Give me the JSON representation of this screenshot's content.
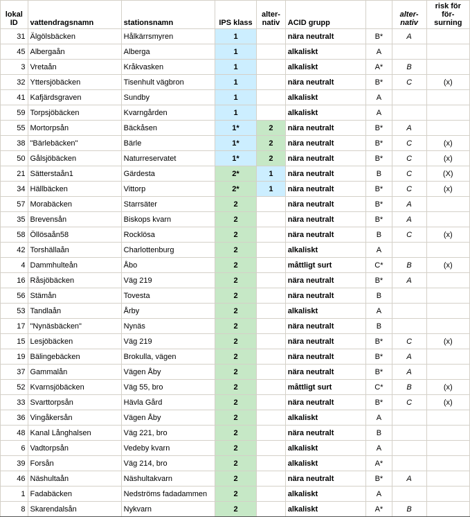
{
  "headers": {
    "lokal_id": [
      "lokal",
      "ID"
    ],
    "vattendragsnamn": [
      "vattendragsnamn"
    ],
    "stationsnamn": [
      "stationsnamn"
    ],
    "ips_klass": [
      "IPS klass"
    ],
    "alt1": [
      "alter-",
      "nativ"
    ],
    "acid_grupp": [
      "ACID grupp"
    ],
    "b": [
      ""
    ],
    "alt2": [
      "alter-",
      "nativ"
    ],
    "risk": [
      "risk för",
      "för-",
      "surning"
    ]
  },
  "rows": [
    {
      "id": "31",
      "vat": "Älgölsbäcken",
      "stn": "Hålkärrsmyren",
      "ips": "1",
      "ipsC": "blue",
      "alt": "",
      "altC": "",
      "acid": "nära neutralt",
      "b": "B*",
      "a2": "A",
      "risk": ""
    },
    {
      "id": "45",
      "vat": "Albergaån",
      "stn": "Alberga",
      "ips": "1",
      "ipsC": "blue",
      "alt": "",
      "altC": "",
      "acid": "alkaliskt",
      "b": "A",
      "a2": "",
      "risk": ""
    },
    {
      "id": "3",
      "vat": "Vretaån",
      "stn": "Kråkvasken",
      "ips": "1",
      "ipsC": "blue",
      "alt": "",
      "altC": "",
      "acid": "alkaliskt",
      "b": "A*",
      "a2": "B",
      "risk": ""
    },
    {
      "id": "32",
      "vat": "Yttersjöbäcken",
      "stn": "Tisenhult vägbron",
      "ips": "1",
      "ipsC": "blue",
      "alt": "",
      "altC": "",
      "acid": "nära neutralt",
      "b": "B*",
      "a2": "C",
      "risk": "(x)"
    },
    {
      "id": "41",
      "vat": "Kafjärdsgraven",
      "stn": "Sundby",
      "ips": "1",
      "ipsC": "blue",
      "alt": "",
      "altC": "",
      "acid": "alkaliskt",
      "b": "A",
      "a2": "",
      "risk": ""
    },
    {
      "id": "59",
      "vat": "Torpsjöbäcken",
      "stn": "Kvarngården",
      "ips": "1",
      "ipsC": "blue",
      "alt": "",
      "altC": "",
      "acid": "alkaliskt",
      "b": "A",
      "a2": "",
      "risk": ""
    },
    {
      "id": "55",
      "vat": "Mortorpsån",
      "stn": "Bäckåsen",
      "ips": "1*",
      "ipsC": "blue",
      "alt": "2",
      "altC": "green",
      "acid": "nära neutralt",
      "b": "B*",
      "a2": "A",
      "risk": ""
    },
    {
      "id": "38",
      "vat": "\"Bärlebäcken\"",
      "stn": "Bärle",
      "ips": "1*",
      "ipsC": "blue",
      "alt": "2",
      "altC": "green",
      "acid": "nära neutralt",
      "b": "B*",
      "a2": "C",
      "risk": "(x)"
    },
    {
      "id": "50",
      "vat": "Gålsjöbäcken",
      "stn": "Naturreservatet",
      "ips": "1*",
      "ipsC": "blue",
      "alt": "2",
      "altC": "green",
      "acid": "nära neutralt",
      "b": "B*",
      "a2": "C",
      "risk": "(x)"
    },
    {
      "id": "21",
      "vat": "Sätterstaån1",
      "stn": "Gärdesta",
      "ips": "2*",
      "ipsC": "green",
      "alt": "1",
      "altC": "blue",
      "acid": "nära neutralt",
      "b": "B",
      "a2": "C",
      "risk": "(X)"
    },
    {
      "id": "34",
      "vat": "Hällbäcken",
      "stn": "Vittorp",
      "ips": "2*",
      "ipsC": "green",
      "alt": "1",
      "altC": "blue",
      "acid": "nära neutralt",
      "b": "B*",
      "a2": "C",
      "risk": "(x)"
    },
    {
      "id": "57",
      "vat": "Morabäcken",
      "stn": "Starrsäter",
      "ips": "2",
      "ipsC": "green",
      "alt": "",
      "altC": "",
      "acid": "nära neutralt",
      "b": "B*",
      "a2": "A",
      "risk": ""
    },
    {
      "id": "35",
      "vat": "Brevensån",
      "stn": "Biskops kvarn",
      "ips": "2",
      "ipsC": "green",
      "alt": "",
      "altC": "",
      "acid": "nära neutralt",
      "b": "B*",
      "a2": "A",
      "risk": ""
    },
    {
      "id": "58",
      "vat": "Öllösaån58",
      "stn": "Rocklösa",
      "ips": "2",
      "ipsC": "green",
      "alt": "",
      "altC": "",
      "acid": "nära neutralt",
      "b": "B",
      "a2": "C",
      "risk": "(x)"
    },
    {
      "id": "42",
      "vat": "Torshällaån",
      "stn": "Charlottenburg",
      "ips": "2",
      "ipsC": "green",
      "alt": "",
      "altC": "",
      "acid": "alkaliskt",
      "b": "A",
      "a2": "",
      "risk": ""
    },
    {
      "id": "4",
      "vat": "Dammhulteån",
      "stn": "Åbo",
      "ips": "2",
      "ipsC": "green",
      "alt": "",
      "altC": "",
      "acid": "måttligt surt",
      "b": "C*",
      "a2": "B",
      "risk": "(x)"
    },
    {
      "id": "16",
      "vat": "Råsjöbäcken",
      "stn": "Väg 219",
      "ips": "2",
      "ipsC": "green",
      "alt": "",
      "altC": "",
      "acid": "nära neutralt",
      "b": "B*",
      "a2": "A",
      "risk": ""
    },
    {
      "id": "56",
      "vat": "Stämån",
      "stn": "Tovesta",
      "ips": "2",
      "ipsC": "green",
      "alt": "",
      "altC": "",
      "acid": "nära neutralt",
      "b": "B",
      "a2": "",
      "risk": ""
    },
    {
      "id": "53",
      "vat": "Tandlaån",
      "stn": "Årby",
      "ips": "2",
      "ipsC": "green",
      "alt": "",
      "altC": "",
      "acid": "alkaliskt",
      "b": "A",
      "a2": "",
      "risk": ""
    },
    {
      "id": "17",
      "vat": "\"Nynäsbäcken\"",
      "stn": "Nynäs",
      "ips": "2",
      "ipsC": "green",
      "alt": "",
      "altC": "",
      "acid": "nära neutralt",
      "b": "B",
      "a2": "",
      "risk": ""
    },
    {
      "id": "15",
      "vat": "Lesjöbäcken",
      "stn": "Väg 219",
      "ips": "2",
      "ipsC": "green",
      "alt": "",
      "altC": "",
      "acid": "nära neutralt",
      "b": "B*",
      "a2": "C",
      "risk": "(x)"
    },
    {
      "id": "19",
      "vat": "Bälingebäcken",
      "stn": "Brokulla, vägen",
      "ips": "2",
      "ipsC": "green",
      "alt": "",
      "altC": "",
      "acid": "nära neutralt",
      "b": "B*",
      "a2": "A",
      "risk": ""
    },
    {
      "id": "37",
      "vat": "Gammalån",
      "stn": "Vägen Åby",
      "ips": "2",
      "ipsC": "green",
      "alt": "",
      "altC": "",
      "acid": "nära neutralt",
      "b": "B*",
      "a2": "A",
      "risk": ""
    },
    {
      "id": "52",
      "vat": "Kvarnsjöbäcken",
      "stn": "Väg 55, bro",
      "ips": "2",
      "ipsC": "green",
      "alt": "",
      "altC": "",
      "acid": "måttligt surt",
      "b": "C*",
      "a2": "B",
      "risk": "(x)"
    },
    {
      "id": "33",
      "vat": "Svarttorpsån",
      "stn": "Hävla Gård",
      "ips": "2",
      "ipsC": "green",
      "alt": "",
      "altC": "",
      "acid": "nära neutralt",
      "b": "B*",
      "a2": "C",
      "risk": "(x)"
    },
    {
      "id": "36",
      "vat": "Vingåkersån",
      "stn": "Vägen Åby",
      "ips": "2",
      "ipsC": "green",
      "alt": "",
      "altC": "",
      "acid": "alkaliskt",
      "b": "A",
      "a2": "",
      "risk": ""
    },
    {
      "id": "48",
      "vat": "Kanal Långhalsen",
      "stn": "Väg 221, bro",
      "ips": "2",
      "ipsC": "green",
      "alt": "",
      "altC": "",
      "acid": "nära neutralt",
      "b": "B",
      "a2": "",
      "risk": ""
    },
    {
      "id": "6",
      "vat": "Vadtorpsån",
      "stn": "Vedeby kvarn",
      "ips": "2",
      "ipsC": "green",
      "alt": "",
      "altC": "",
      "acid": "alkaliskt",
      "b": "A",
      "a2": "",
      "risk": ""
    },
    {
      "id": "39",
      "vat": "Forsån",
      "stn": "Väg 214, bro",
      "ips": "2",
      "ipsC": "green",
      "alt": "",
      "altC": "",
      "acid": "alkaliskt",
      "b": "A*",
      "a2": "",
      "risk": ""
    },
    {
      "id": "46",
      "vat": "Näshultaån",
      "stn": "Näshultakvarn",
      "ips": "2",
      "ipsC": "green",
      "alt": "",
      "altC": "",
      "acid": "nära neutralt",
      "b": "B*",
      "a2": "A",
      "risk": ""
    },
    {
      "id": "1",
      "vat": "Fadabäcken",
      "stn": "Nedströms fadadammen",
      "ips": "2",
      "ipsC": "green",
      "alt": "",
      "altC": "",
      "acid": "alkaliskt",
      "b": "A",
      "a2": "",
      "risk": ""
    },
    {
      "id": "8",
      "vat": "Skarendalsån",
      "stn": "Nykvarn",
      "ips": "2",
      "ipsC": "green",
      "alt": "",
      "altC": "",
      "acid": "alkaliskt",
      "b": "A*",
      "a2": "B",
      "risk": ""
    }
  ]
}
